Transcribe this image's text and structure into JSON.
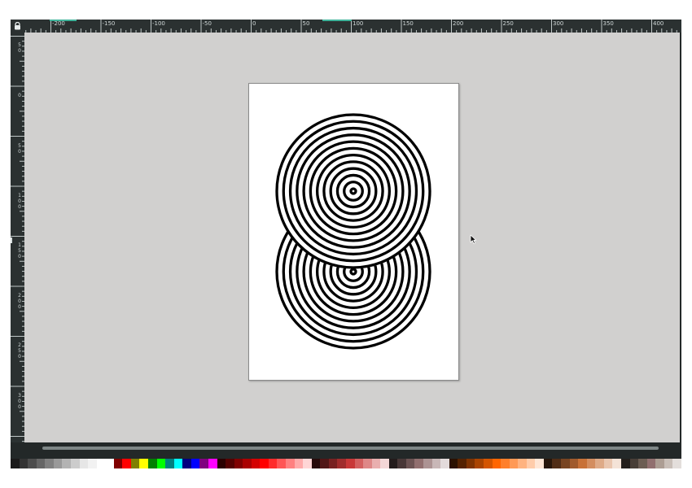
{
  "app": {
    "lock_icon": "lock-icon"
  },
  "horizontal_ruler": {
    "labels": [
      "-200",
      "-150",
      "-100",
      "-50",
      "0",
      "50",
      "100",
      "150",
      "200",
      "250",
      "300",
      "350",
      "400"
    ],
    "accent_color": "#3fb39a"
  },
  "vertical_ruler": {
    "labels": [
      [
        "5",
        "0"
      ],
      [
        "0"
      ],
      [
        "5",
        "0"
      ],
      [
        "1",
        "0",
        "0"
      ],
      [
        "1",
        "5",
        "0"
      ],
      [
        "2",
        "0",
        "0"
      ],
      [
        "2",
        "5",
        "0"
      ],
      [
        "3",
        "0",
        "0"
      ],
      [
        "3"
      ]
    ]
  },
  "canvas": {
    "background_color": "#d1d0cf",
    "page_color": "#ffffff",
    "artwork": {
      "type": "double-spiral",
      "stroke_color": "#000000",
      "ring_count": 12
    },
    "pointer_icon": "mouse-pointer-icon"
  },
  "palette": {
    "colors": [
      "#1a1a1a",
      "#333333",
      "#4d4d4d",
      "#666666",
      "#808080",
      "#999999",
      "#b3b3b3",
      "#cccccc",
      "#e6e6e6",
      "#f2f2f2",
      "#ffffff",
      "#ffffff",
      "#800000",
      "#ff0000",
      "#808000",
      "#ffff00",
      "#008000",
      "#00ff00",
      "#008080",
      "#00ffff",
      "#000080",
      "#0000ff",
      "#800080",
      "#ff00ff",
      "#2b0000",
      "#550000",
      "#800000",
      "#aa0000",
      "#d40000",
      "#ff0000",
      "#ff2a2a",
      "#ff5555",
      "#ff8080",
      "#ffaaaa",
      "#ffd5d5",
      "#280b0b",
      "#501616",
      "#782121",
      "#a02c2c",
      "#c83737",
      "#d35f5f",
      "#de8787",
      "#e9afaf",
      "#f4d7d7",
      "#241c1c",
      "#483737",
      "#6c5353",
      "#916f6f",
      "#ac9393",
      "#c8b7b7",
      "#e3dbdb",
      "#2b1100",
      "#552200",
      "#803300",
      "#aa4400",
      "#d45500",
      "#ff6600",
      "#ff7f2a",
      "#ff9955",
      "#ffb380",
      "#ffccaa",
      "#ffe6d5",
      "#28170b",
      "#502d16",
      "#784421",
      "#a05a2c",
      "#c87137",
      "#d38d5f",
      "#deaa87",
      "#e9c6af",
      "#f4e3d7",
      "#241f1c",
      "#483e37",
      "#6c5d53",
      "#916f6f",
      "#ac9d93",
      "#c8beb7",
      "#e3dedb"
    ]
  }
}
